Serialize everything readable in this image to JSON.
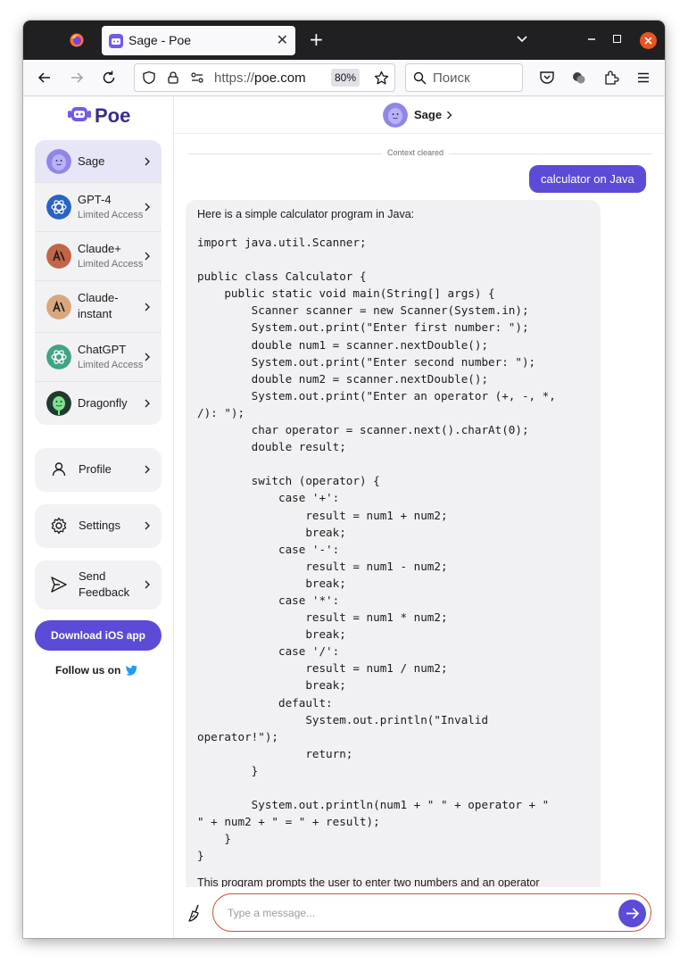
{
  "browser": {
    "tab_title": "Sage - Poe",
    "url_scheme": "https://",
    "url_host": "poe.com",
    "zoom": "80%",
    "search_placeholder": "Поиск"
  },
  "sidebar": {
    "logo_text": "Poe",
    "bots": [
      {
        "name": "Sage",
        "sub": ""
      },
      {
        "name": "GPT-4",
        "sub": "Limited Access"
      },
      {
        "name": "Claude+",
        "sub": "Limited Access"
      },
      {
        "name": "Claude-\ninstant",
        "sub": ""
      },
      {
        "name": "ChatGPT",
        "sub": "Limited Access"
      },
      {
        "name": "Dragonfly",
        "sub": ""
      }
    ],
    "profile_label": "Profile",
    "settings_label": "Settings",
    "feedback_label": "Send\nFeedback",
    "ios_button": "Download iOS app",
    "follow_text": "Follow us on"
  },
  "chat": {
    "bot_name": "Sage",
    "context_cleared": "Context cleared",
    "user_message": "calculator on Java",
    "bot_intro": "Here is a simple calculator program in Java:",
    "code": "import java.util.Scanner;\n\npublic class Calculator {\n    public static void main(String[] args) {\n        Scanner scanner = new Scanner(System.in);\n        System.out.print(\"Enter first number: \");\n        double num1 = scanner.nextDouble();\n        System.out.print(\"Enter second number: \");\n        double num2 = scanner.nextDouble();\n        System.out.print(\"Enter an operator (+, -, *,\n/): \");\n        char operator = scanner.next().charAt(0);\n        double result;\n\n        switch (operator) {\n            case '+':\n                result = num1 + num2;\n                break;\n            case '-':\n                result = num1 - num2;\n                break;\n            case '*':\n                result = num1 * num2;\n                break;\n            case '/':\n                result = num1 / num2;\n                break;\n            default:\n                System.out.println(\"Invalid\noperator!\");\n                return;\n        }\n\n        System.out.println(num1 + \" \" + operator + \"\n\" + num2 + \" = \" + result);\n    }\n}",
    "bot_outro": "This program prompts the user to enter two numbers and an operator",
    "input_placeholder": "Type a message..."
  },
  "colors": {
    "accent": "#5b4bd6",
    "input_border": "#c9533d",
    "window_close": "#e95420"
  }
}
